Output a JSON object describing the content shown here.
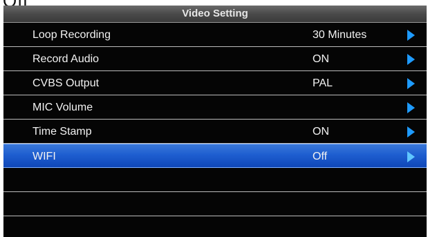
{
  "top_partial_text": "Off",
  "header": {
    "title": "Video Setting"
  },
  "menu": {
    "items": [
      {
        "label": "Loop Recording",
        "value": "30 Minutes"
      },
      {
        "label": "Record Audio",
        "value": "ON"
      },
      {
        "label": "CVBS Output",
        "value": "PAL"
      },
      {
        "label": "MIC Volume",
        "value": ""
      },
      {
        "label": "Time Stamp",
        "value": "ON"
      },
      {
        "label": "WIFI",
        "value": "Off"
      }
    ],
    "selected_index": 5
  },
  "icons": {
    "submenu_arrow": "triangle-right-icon"
  },
  "colors": {
    "background": "#050505",
    "selection": "#1e5ed0",
    "arrow": "#1e9bff",
    "text": "#f2f2f2"
  }
}
